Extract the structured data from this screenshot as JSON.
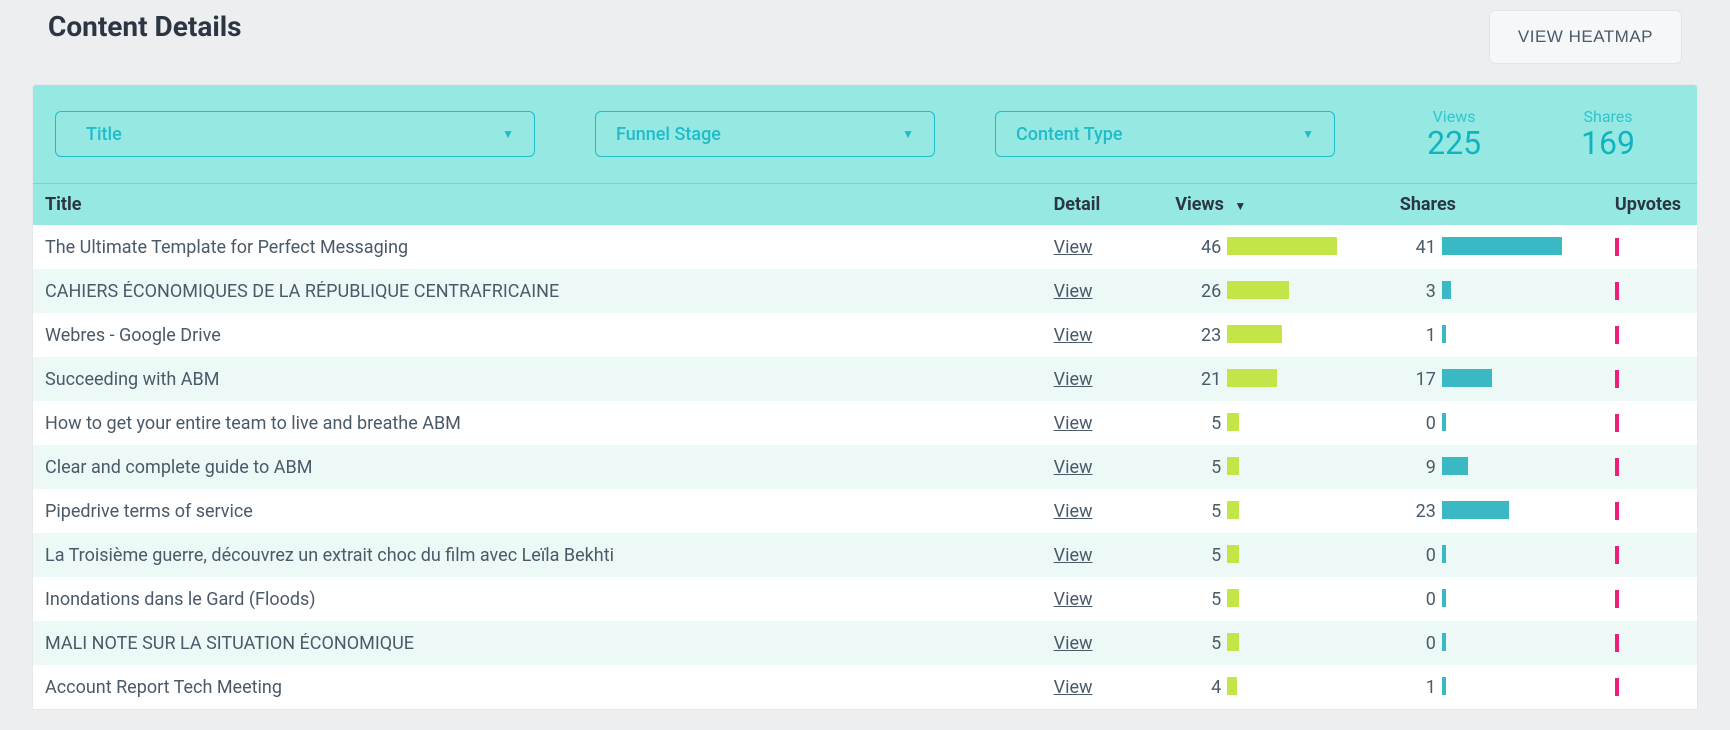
{
  "header": {
    "title": "Content Details",
    "heatmap_button": "VIEW HEATMAP"
  },
  "filters": {
    "title_label": "Title",
    "funnel_label": "Funnel Stage",
    "type_label": "Content Type"
  },
  "summary": {
    "views_label": "Views",
    "views_value": "225",
    "shares_label": "Shares",
    "shares_value": "169"
  },
  "columns": {
    "title": "Title",
    "detail": "Detail",
    "views": "Views",
    "shares": "Shares",
    "upvotes": "Upvotes"
  },
  "detail_link_label": "View",
  "max_views": 46,
  "max_shares": 41,
  "rows": [
    {
      "title": "The Ultimate Template for Perfect Messaging",
      "views": 46,
      "shares": 41
    },
    {
      "title": "CAHIERS ÉCONOMIQUES DE LA RÉPUBLIQUE CENTRAFRICAINE",
      "views": 26,
      "shares": 3
    },
    {
      "title": "Webres - Google Drive",
      "views": 23,
      "shares": 1
    },
    {
      "title": "Succeeding with ABM",
      "views": 21,
      "shares": 17
    },
    {
      "title": "How to get your entire team to live and breathe ABM",
      "views": 5,
      "shares": 0
    },
    {
      "title": "Clear and complete guide to ABM",
      "views": 5,
      "shares": 9
    },
    {
      "title": "Pipedrive terms of service",
      "views": 5,
      "shares": 23
    },
    {
      "title": "La Troisième guerre, découvrez un extrait choc du film avec Leïla Bekhti",
      "views": 5,
      "shares": 0
    },
    {
      "title": "Inondations dans le Gard (Floods)",
      "views": 5,
      "shares": 0
    },
    {
      "title": "MALI NOTE SUR LA SITUATION ÉCONOMIQUE",
      "views": 5,
      "shares": 0
    },
    {
      "title": "Account Report Tech Meeting",
      "views": 4,
      "shares": 1
    }
  ]
}
